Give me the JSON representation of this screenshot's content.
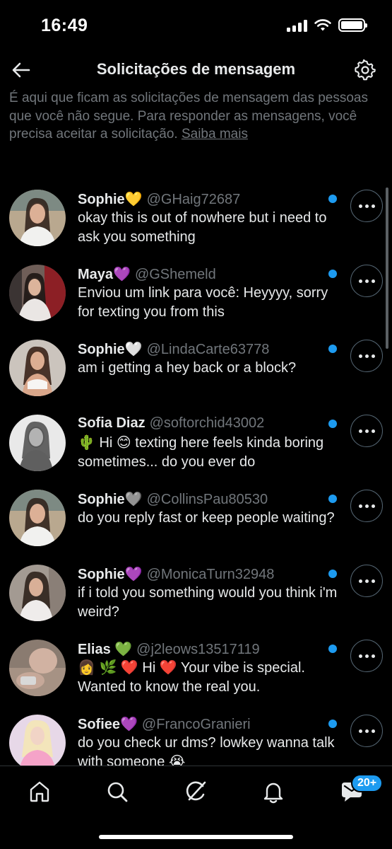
{
  "status_bar": {
    "time": "16:49"
  },
  "header": {
    "title": "Solicitações de mensagem",
    "back_icon": "arrow-left-icon",
    "settings_icon": "gear-icon"
  },
  "info": {
    "text": "É aqui que ficam as solicitações de mensagem das pessoas que você não segue. Para responder as mensagens, você precisa aceitar a solicitação. ",
    "link": "Saiba mais"
  },
  "colors": {
    "accent": "#1d9bf0",
    "muted": "#71767b",
    "text": "#e7e9ea",
    "background": "#000000"
  },
  "requests": [
    {
      "name": "Sophie💛",
      "handle": "@GHaig72687",
      "message": "okay this is out of nowhere but i need to ask you something",
      "unread": true
    },
    {
      "name": "Maya💜",
      "handle": "@GShemeld",
      "message": "Enviou um link para você: Heyyyy, sorry for texting you from this",
      "unread": true
    },
    {
      "name": "Sophie🤍",
      "handle": "@LindaCarte63778",
      "message": "am i getting a hey back or a block?",
      "unread": true
    },
    {
      "name": "Sofia Diaz",
      "handle": "@softorchid43002",
      "message": "🌵 Hi 😊 texting here feels kinda boring sometimes... do you ever do",
      "unread": true
    },
    {
      "name": "Sophie🩶",
      "handle": "@CollinsPau80530",
      "message": "do you reply fast or keep people waiting?",
      "unread": true
    },
    {
      "name": "Sophie💜",
      "handle": "@MonicaTurn32948",
      "message": "if i told you something would you think i'm weird?",
      "unread": true
    },
    {
      "name": "Elias 💚",
      "handle": "@j2leows13517119",
      "message": "👩 🌿 ❤️ Hi ❤️ Your vibe is special. Wanted to know the real you.",
      "unread": true
    },
    {
      "name": "Sofiee💜",
      "handle": "@FrancoGranieri",
      "message": "do you check ur dms? lowkey wanna talk with someone 😭",
      "unread": true
    }
  ],
  "bottom_nav": {
    "items": [
      "home-icon",
      "search-icon",
      "grok-icon",
      "bell-icon",
      "messages-icon"
    ],
    "messages_badge": "20+"
  }
}
